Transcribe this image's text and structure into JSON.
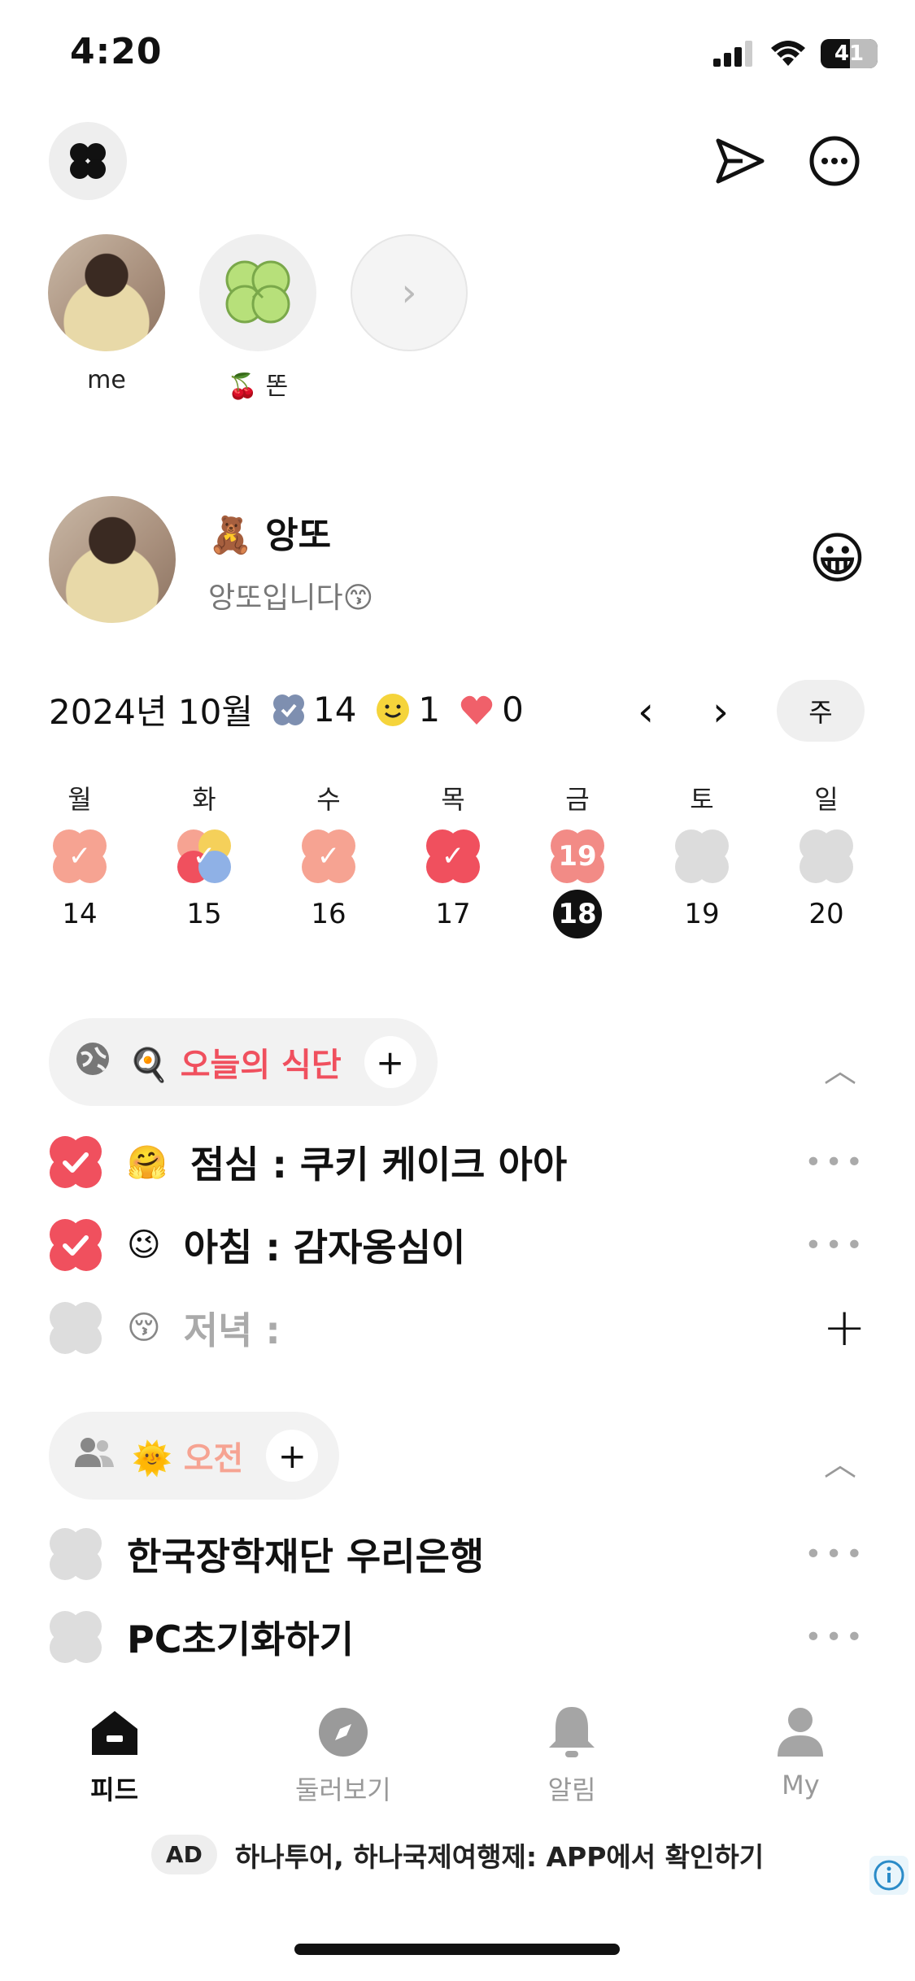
{
  "status": {
    "time": "4:20",
    "battery": "41"
  },
  "friends": [
    {
      "name": "me"
    },
    {
      "name": "🍒 똔"
    }
  ],
  "profile": {
    "name": "🧸 앙또",
    "bio": "앙또입니다😙",
    "mood_emoji": "😀"
  },
  "month": {
    "label": "2024년 10월",
    "stats": [
      {
        "icon": "check-clover-icon",
        "count": "14"
      },
      {
        "icon": "smile-icon",
        "count": "1"
      },
      {
        "icon": "heart-icon",
        "count": "0"
      }
    ],
    "prev": "‹",
    "next": "›",
    "view_toggle": "주"
  },
  "week": [
    {
      "day": "월",
      "date": "14",
      "mark": "✓",
      "color": "#f6a392"
    },
    {
      "day": "화",
      "date": "15",
      "mark": "✓",
      "color": "multi"
    },
    {
      "day": "수",
      "date": "16",
      "mark": "✓",
      "color": "#f6a392"
    },
    {
      "day": "목",
      "date": "17",
      "mark": "✓",
      "color": "#f0505e"
    },
    {
      "day": "금",
      "date": "18",
      "mark": "19",
      "color": "#f28b86",
      "today": true
    },
    {
      "day": "토",
      "date": "19",
      "mark": "",
      "color": "#dcdcdc"
    },
    {
      "day": "일",
      "date": "20",
      "mark": "",
      "color": "#dcdcdc"
    }
  ],
  "sections": [
    {
      "title": "🍳 오늘의 식단",
      "title_color": "#f0505e",
      "icon": "globe-icon",
      "items": [
        {
          "emoji": "🤗",
          "text": "점심 : 쿠키 케이크 아아",
          "done": true
        },
        {
          "emoji": "😉",
          "text": "아침 : 감자옹심이",
          "done": true
        },
        {
          "emoji": "😚",
          "text": "저녁 :",
          "done": false,
          "placeholder": true
        }
      ]
    },
    {
      "title": "🌞 오전",
      "title_color": "#f6a392",
      "icon": "people-icon",
      "items": [
        {
          "emoji": "",
          "text": "한국장학재단 우리은행",
          "done": false
        },
        {
          "emoji": "",
          "text": "PC초기화하기",
          "done": false
        }
      ]
    }
  ],
  "more_glyph": "•••",
  "add_glyph": "+",
  "collapse_glyph": "︿",
  "tabs": [
    {
      "label": "피드",
      "icon": "home-icon",
      "active": true
    },
    {
      "label": "둘러보기",
      "icon": "compass-icon",
      "active": false
    },
    {
      "label": "알림",
      "icon": "bell-icon",
      "active": false
    },
    {
      "label": "My",
      "icon": "person-icon",
      "active": false
    }
  ],
  "ad": {
    "badge": "AD",
    "text": "하나투어, 하나국제여행제: APP에서 확인하기"
  }
}
